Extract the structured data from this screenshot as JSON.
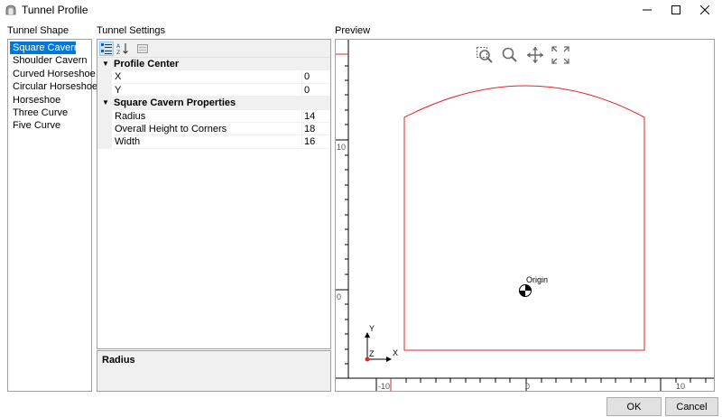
{
  "window": {
    "title": "Tunnel Profile",
    "icons": [
      "tunnel-app-icon",
      "minimize-icon",
      "maximize-icon",
      "close-icon"
    ]
  },
  "labels": {
    "tunnel_shape": "Tunnel Shape",
    "tunnel_settings": "Tunnel Settings",
    "preview": "Preview"
  },
  "shapes": {
    "selected": "Square Cavern",
    "items": [
      "Square Cavern",
      "Shoulder Cavern",
      "Curved Horseshoe",
      "Circular Horseshoe",
      "Horseshoe",
      "Three Curve",
      "Five Curve"
    ]
  },
  "settings": {
    "toolbar": [
      "categorized-icon",
      "alphabetical-icon",
      "property-pages-icon"
    ],
    "categories": [
      {
        "title": "Profile Center",
        "props": [
          {
            "name": "X",
            "value": "0"
          },
          {
            "name": "Y",
            "value": "0"
          }
        ]
      },
      {
        "title": "Square Cavern Properties",
        "props": [
          {
            "name": "Radius",
            "value": "14"
          },
          {
            "name": "Overall Height to Corners",
            "value": "18"
          },
          {
            "name": "Width",
            "value": "16"
          }
        ]
      }
    ],
    "description_title": "Radius"
  },
  "preview": {
    "toolbar": [
      "zoom-window-icon",
      "zoom-icon",
      "pan-icon",
      "zoom-extents-icon"
    ],
    "origin_label": "Origin",
    "axis_x": "X",
    "axis_y": "Y",
    "axis_z": "Z",
    "ruler_top": [
      "-10",
      "0",
      "10"
    ],
    "ruler_left": [
      "10",
      "0"
    ],
    "colors": {
      "profile": "#e0242a",
      "ruler": "#000000"
    }
  },
  "buttons": {
    "ok": "OK",
    "cancel": "Cancel"
  }
}
